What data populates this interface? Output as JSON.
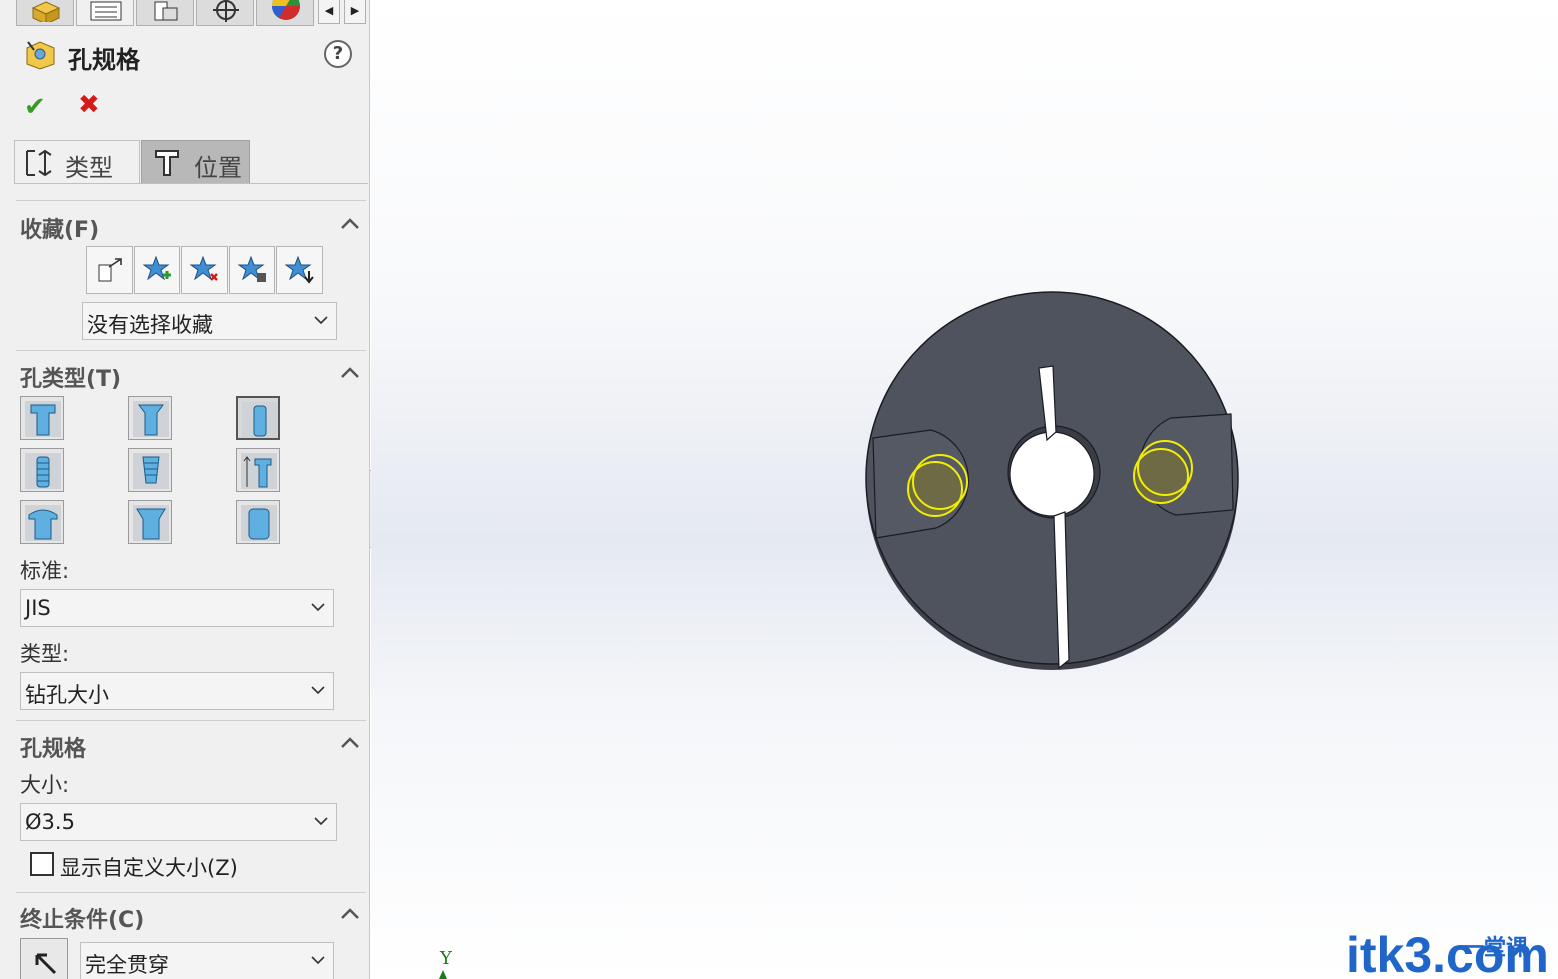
{
  "panel": {
    "title": "孔规格",
    "help": "?",
    "ok": "✔",
    "cancel": "✖",
    "tabs": [
      {
        "label": "类型"
      },
      {
        "label": "位置"
      }
    ],
    "favorites": {
      "title": "收藏(F)",
      "selected": "没有选择收藏"
    },
    "hole_type": {
      "title": "孔类型(T)",
      "standard_label": "标准:",
      "standard_value": "JIS",
      "type_label": "类型:",
      "type_value": "钻孔大小"
    },
    "hole_spec": {
      "title": "孔规格",
      "size_label": "大小:",
      "size_value": "Ø3.5",
      "custom_size_label": "显示自定义大小(Z)",
      "custom_size_checked": false
    },
    "end_condition": {
      "title": "终止条件(C)",
      "value": "完全贯穿"
    }
  },
  "viewport": {
    "axis_label": "Y",
    "watermark": "itk3.com",
    "watermark_sub": "一堂课"
  },
  "colors": {
    "panel_bg": "#f0f0f0",
    "model_face": "#4f535e",
    "highlight": "#f2ee00",
    "ok_green": "#3a9a28",
    "cancel_red": "#d41a1a",
    "watermark_blue": "#1f66c8"
  }
}
